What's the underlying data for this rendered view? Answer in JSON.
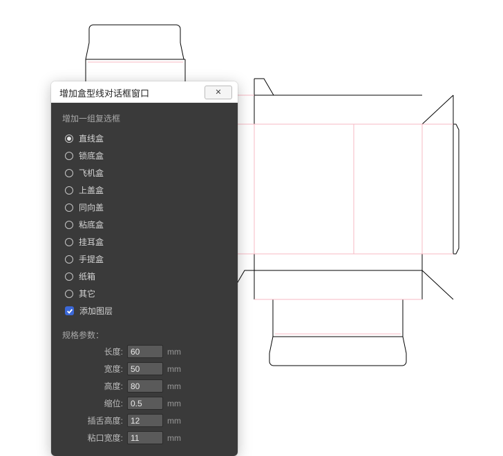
{
  "dialog": {
    "title": "增加盒型线对话框窗口",
    "close_glyph": "✕",
    "group_label": "增加一组复选框",
    "radios": [
      {
        "label": "直线盒",
        "checked": true
      },
      {
        "label": "锁底盒",
        "checked": false
      },
      {
        "label": "飞机盒",
        "checked": false
      },
      {
        "label": "上盖盒",
        "checked": false
      },
      {
        "label": "同向盖",
        "checked": false
      },
      {
        "label": "粘底盒",
        "checked": false
      },
      {
        "label": "挂耳盒",
        "checked": false
      },
      {
        "label": "手提盒",
        "checked": false
      },
      {
        "label": "纸箱",
        "checked": false
      },
      {
        "label": "其它",
        "checked": false
      }
    ],
    "checkbox": {
      "label": "添加图层",
      "checked": true
    },
    "params_title": "规格参数：",
    "params": [
      {
        "label": "长度:",
        "value": "60",
        "unit": "mm"
      },
      {
        "label": "宽度:",
        "value": "50",
        "unit": "mm"
      },
      {
        "label": "高度:",
        "value": "80",
        "unit": "mm"
      },
      {
        "label": "缩位:",
        "value": "0.5",
        "unit": "mm"
      },
      {
        "label": "插舌高度:",
        "value": "12",
        "unit": "mm"
      },
      {
        "label": "粘口宽度:",
        "value": "11",
        "unit": "mm"
      }
    ]
  }
}
